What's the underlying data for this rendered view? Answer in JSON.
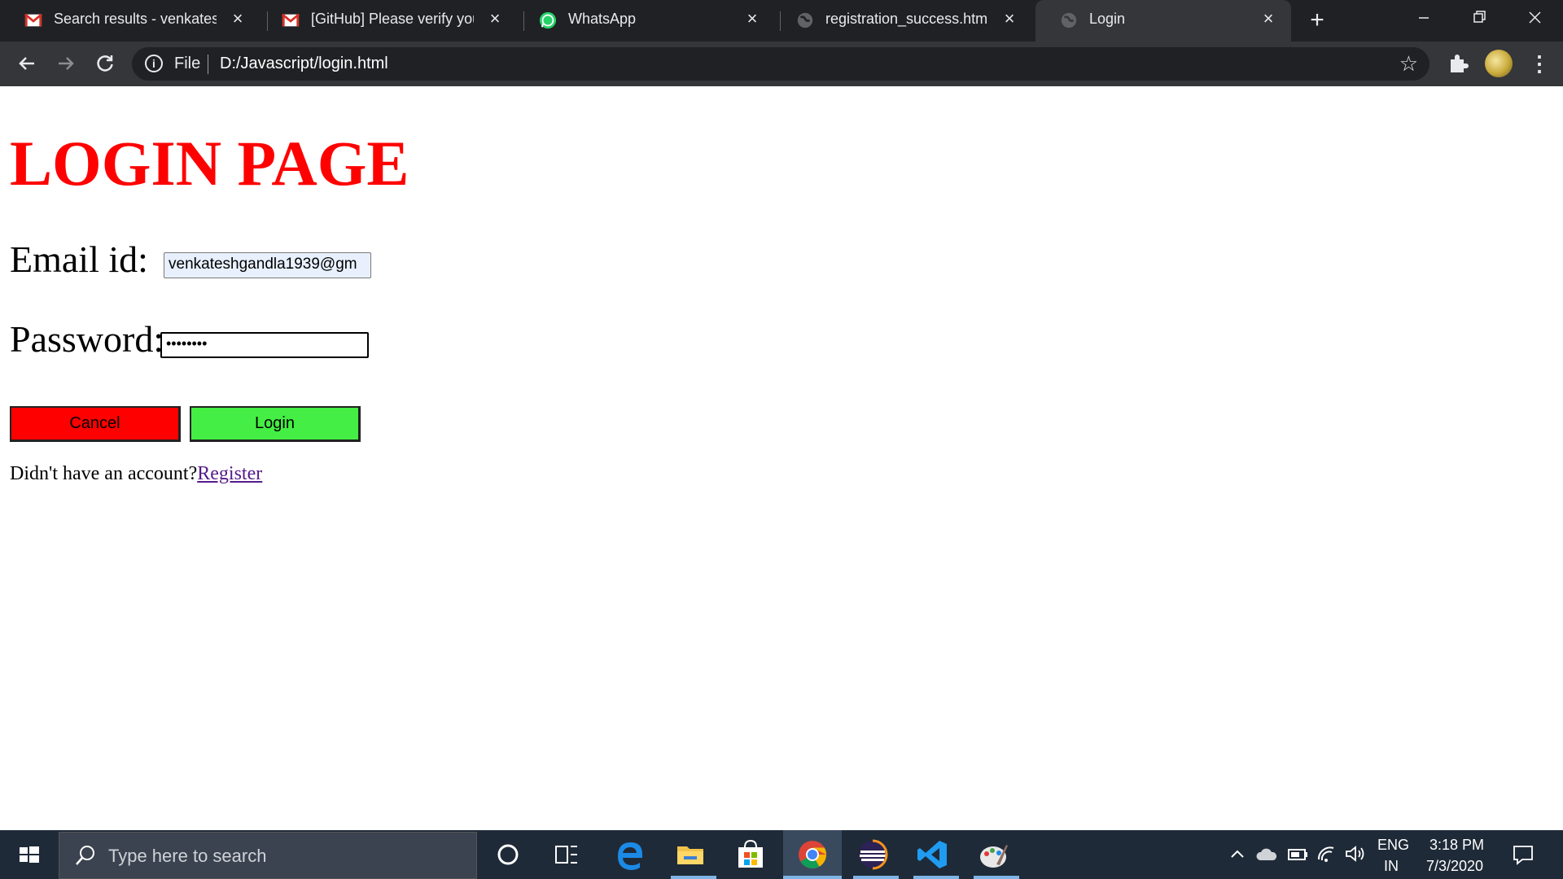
{
  "browser": {
    "tabs": [
      {
        "title": "Search results - venkateshg",
        "icon": "gmail-icon",
        "active": false
      },
      {
        "title": "[GitHub] Please verify your",
        "icon": "gmail-icon",
        "active": false
      },
      {
        "title": "WhatsApp",
        "icon": "whatsapp-icon",
        "active": false
      },
      {
        "title": "registration_success.html?U",
        "icon": "globe-icon",
        "active": false
      },
      {
        "title": "Login",
        "icon": "globe-icon",
        "active": true
      }
    ],
    "address": {
      "scheme_label": "File",
      "url": "D:/Javascript/login.html"
    }
  },
  "page": {
    "title": "LOGIN PAGE",
    "email_label": "Email id:",
    "email_value": "venkateshgandla1939@gm",
    "password_label": "Password:",
    "password_value": "••••••••",
    "cancel_label": "Cancel",
    "login_label": "Login",
    "footer_text": "Didn't have an account?",
    "register_link": "Register"
  },
  "colors": {
    "title": "#ff0000",
    "cancel_button": "#ff0000",
    "login_button": "#44ee44",
    "link": "#551a8b"
  },
  "taskbar": {
    "search_placeholder": "Type here to search",
    "language_line1": "ENG",
    "language_line2": "IN",
    "time": "3:18 PM",
    "date": "7/3/2020",
    "pinned": [
      "cortana-icon",
      "task-view-icon",
      "edge-icon",
      "file-explorer-icon",
      "store-icon",
      "chrome-icon",
      "eclipse-icon",
      "vscode-icon",
      "paint-icon"
    ]
  }
}
